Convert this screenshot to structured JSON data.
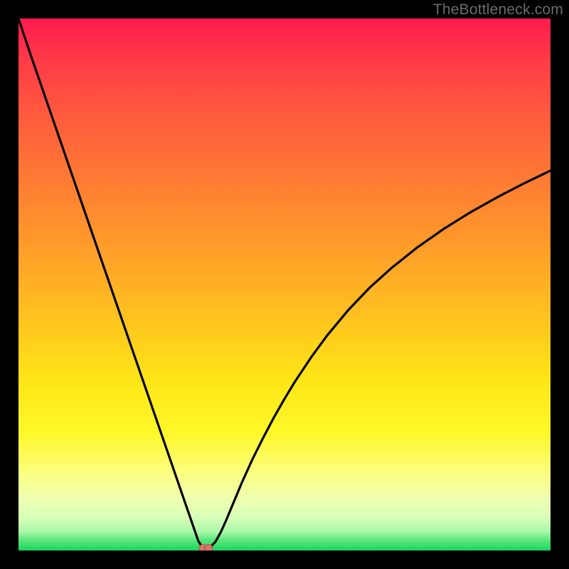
{
  "watermark": "TheBottleneck.com",
  "chart_data": {
    "type": "line",
    "title": "",
    "xlabel": "",
    "ylabel": "",
    "xlim": [
      0,
      100
    ],
    "ylim": [
      0,
      100
    ],
    "grid": false,
    "series": [
      {
        "name": "bottleneck-curve",
        "x": [
          0,
          2,
          4,
          6,
          8,
          10,
          12,
          14,
          16,
          18,
          20,
          22,
          24,
          26,
          28,
          30,
          31,
          32,
          33,
          33.8,
          34.5,
          35.2,
          36,
          37,
          38,
          39,
          40,
          42,
          44,
          46,
          48,
          50,
          52,
          55,
          58,
          62,
          66,
          70,
          75,
          80,
          85,
          90,
          95,
          100
        ],
        "y": [
          100,
          94,
          88.2,
          82.4,
          76.6,
          70.8,
          65,
          59.2,
          53.4,
          47.6,
          41.8,
          36,
          30.2,
          24.4,
          18.6,
          12.8,
          9.9,
          7.0,
          4.1,
          1.8,
          0.7,
          0.4,
          0.6,
          1.6,
          3.4,
          5.6,
          8.0,
          12.8,
          17.2,
          21.2,
          25.0,
          28.5,
          31.8,
          36.3,
          40.4,
          45.2,
          49.4,
          53.0,
          57.0,
          60.5,
          63.6,
          66.4,
          69.0,
          71.4
        ]
      }
    ],
    "marker": {
      "name": "bottleneck-point",
      "x": 35.2,
      "y": 0.4
    },
    "background_gradient": {
      "type": "vertical",
      "stops": [
        {
          "pos": 0.0,
          "color": "#ff1a4d"
        },
        {
          "pos": 0.3,
          "color": "#ff7a34"
        },
        {
          "pos": 0.6,
          "color": "#ffd21c"
        },
        {
          "pos": 0.8,
          "color": "#fff82a"
        },
        {
          "pos": 0.92,
          "color": "#e6ffb0"
        },
        {
          "pos": 1.0,
          "color": "#19d760"
        }
      ]
    }
  }
}
